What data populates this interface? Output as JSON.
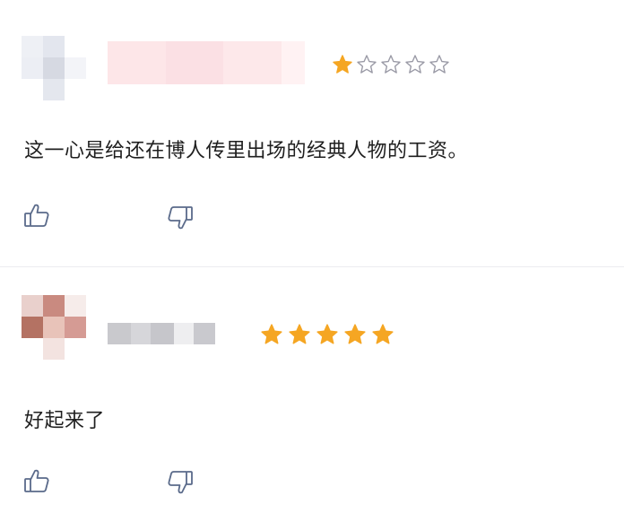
{
  "comments": [
    {
      "rating": 1,
      "rating_max": 5,
      "text": "这一心是给还在博人传里出场的经典人物的工资。",
      "icons": {
        "like": "thumbs-up-icon",
        "dislike": "thumbs-down-icon"
      }
    },
    {
      "rating": 5,
      "rating_max": 5,
      "text": "好起来了",
      "icons": {
        "like": "thumbs-up-icon",
        "dislike": "thumbs-down-icon"
      }
    }
  ],
  "colors": {
    "star_filled": "#f5a623",
    "star_empty_stroke": "#9a9aa6",
    "icon_stroke": "#5a6a8a",
    "divider": "#ececf0",
    "text": "#1f1f1f"
  }
}
